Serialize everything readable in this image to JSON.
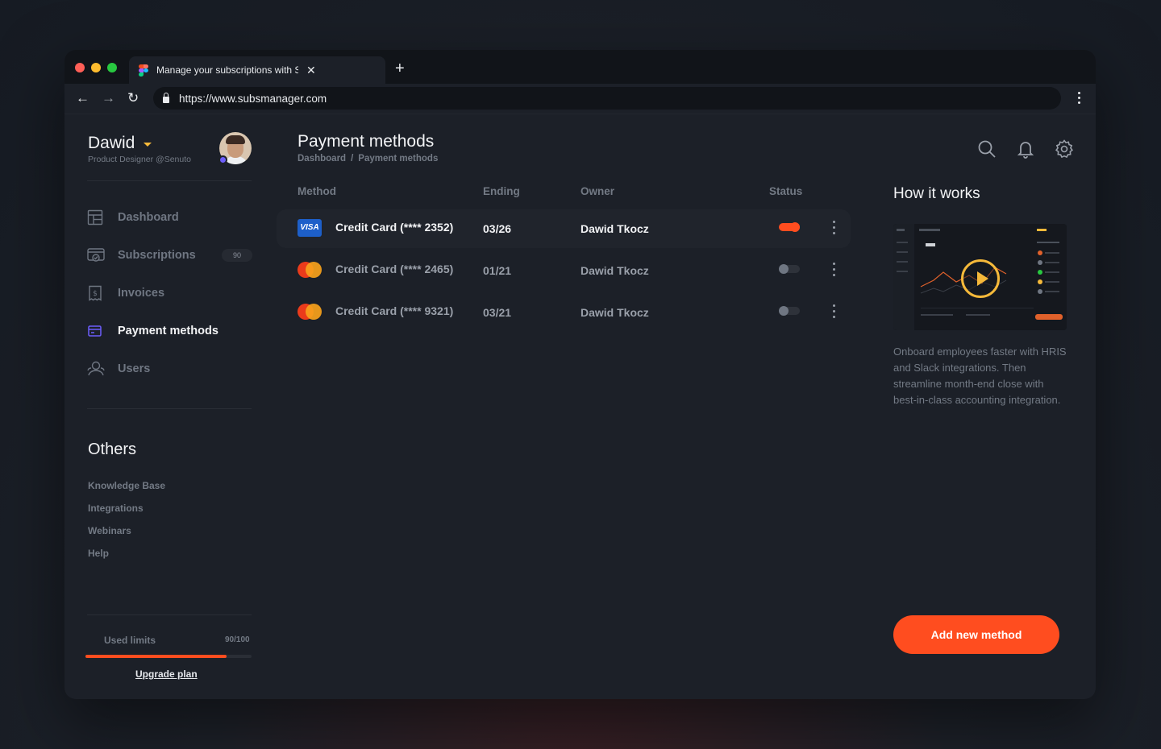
{
  "browser": {
    "tab_title": "Manage your subscriptions with SubsManager",
    "url": "https://www.subsmanager.com"
  },
  "user": {
    "name": "Dawid",
    "role": "Product Designer @Senuto"
  },
  "sidebar": {
    "items": [
      {
        "label": "Dashboard",
        "icon": "dashboard-icon"
      },
      {
        "label": "Subscriptions",
        "icon": "subscriptions-icon",
        "badge": "90"
      },
      {
        "label": "Invoices",
        "icon": "invoice-icon"
      },
      {
        "label": "Payment methods",
        "icon": "credit-card-icon",
        "active": true
      },
      {
        "label": "Users",
        "icon": "users-icon"
      }
    ],
    "others_title": "Others",
    "others": [
      "Knowledge Base",
      "Integrations",
      "Webinars",
      "Help"
    ],
    "limits": {
      "label": "Used limits",
      "value": "90/100",
      "fraction": 0.85
    },
    "upgrade_label": "Upgrade plan"
  },
  "main": {
    "title": "Payment methods",
    "breadcrumb": [
      "Dashboard",
      "/",
      "Payment methods"
    ],
    "columns": [
      "Method",
      "Ending",
      "Owner",
      "Status"
    ],
    "rows": [
      {
        "method": "Credit Card (**** 2352)",
        "brand": "VISA",
        "ending": "03/26",
        "owner": "Dawid Tkocz",
        "active": true
      },
      {
        "method": "Credit Card (**** 2465)",
        "brand": "mastercard",
        "ending": "01/21",
        "owner": "Dawid Tkocz",
        "active": false
      },
      {
        "method": "Credit Card (**** 9321)",
        "brand": "mastercard",
        "ending": "03/21",
        "owner": "Dawid Tkocz",
        "active": false
      }
    ]
  },
  "right": {
    "title": "How it works",
    "description": "Onboard employees faster with HRIS and Slack integrations. Then streamline month-end close with best-in-class accounting integration.",
    "cta_label": "Add new method"
  },
  "colors": {
    "accent": "#ff4d1f",
    "highlight": "#f5b93a",
    "visa": "#1d5fc9",
    "status_dot": "#6d5efc"
  }
}
